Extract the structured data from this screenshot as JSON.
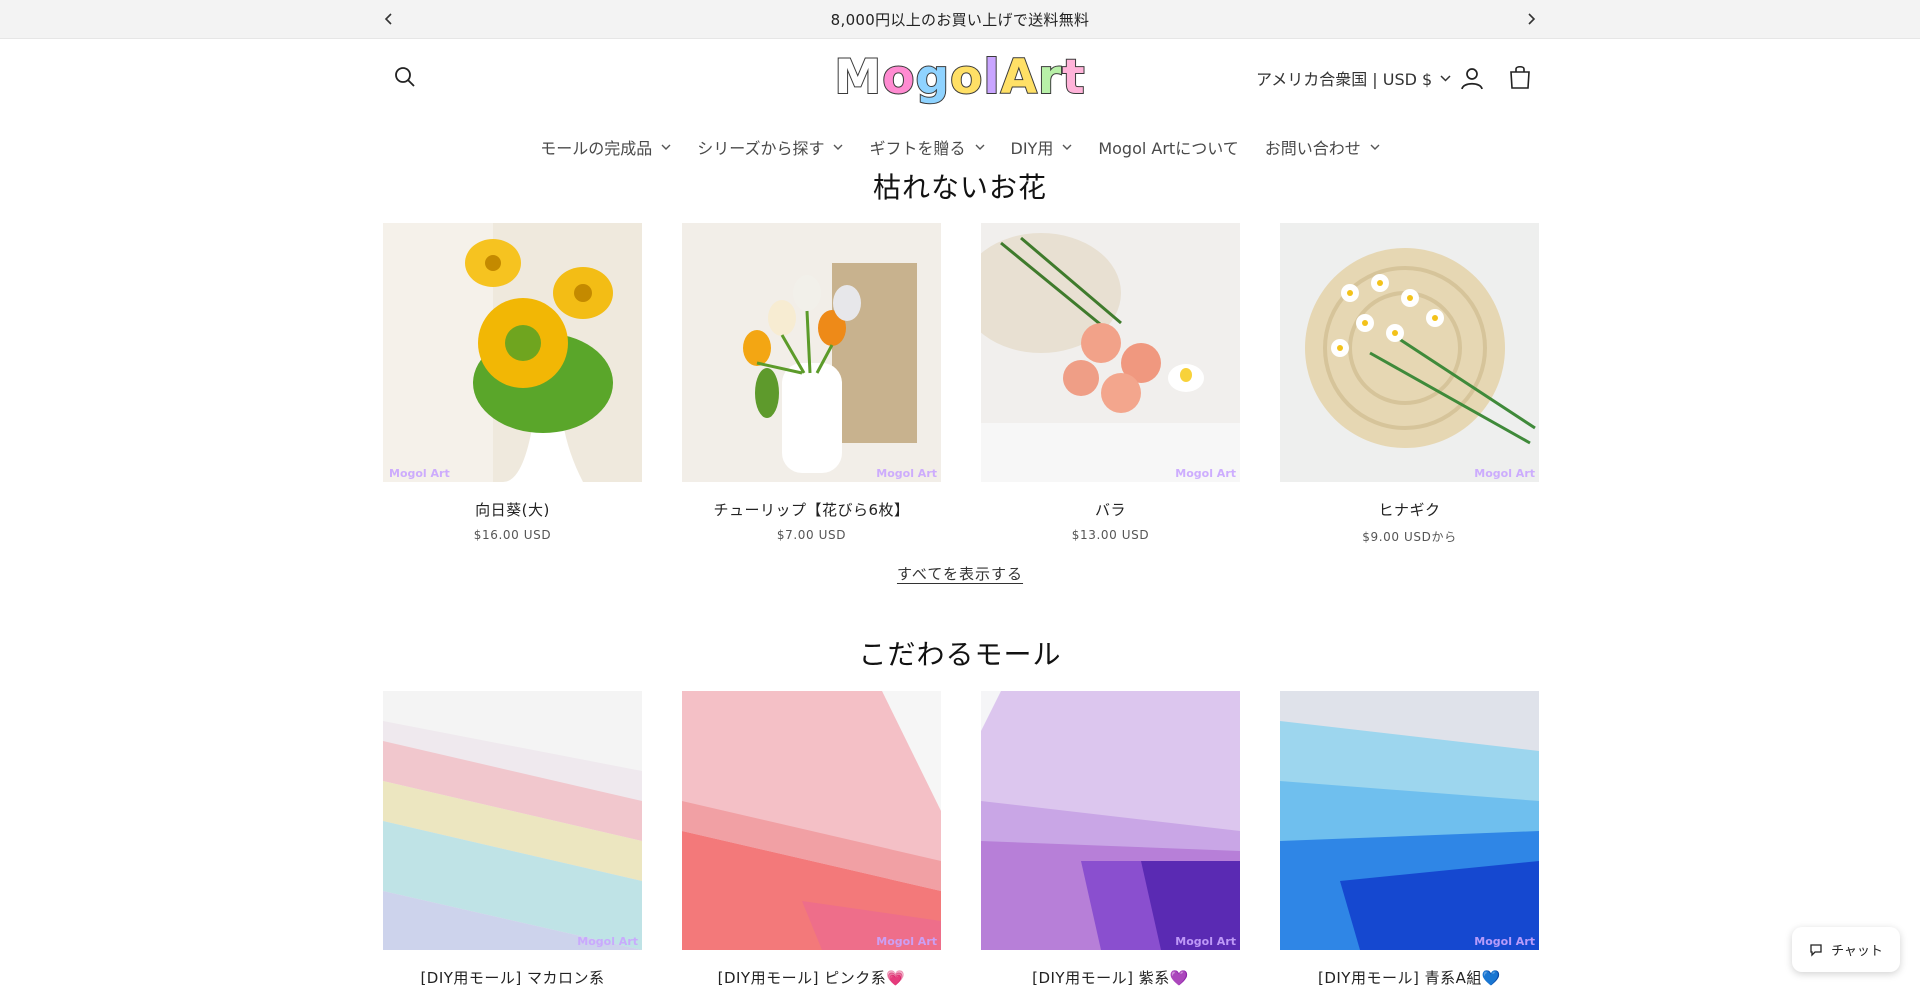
{
  "announcement": {
    "text": "8,000円以上のお買い上げで送料無料"
  },
  "header": {
    "logo_text": "Mogol Art",
    "logo_letters": [
      {
        "ch": "M",
        "color": "#ffffff"
      },
      {
        "ch": "o",
        "color": "#ff8bd1"
      },
      {
        "ch": "g",
        "color": "#8fd3ff"
      },
      {
        "ch": "o",
        "color": "#ffe066"
      },
      {
        "ch": "l",
        "color": "#c9a5ff"
      },
      {
        "ch": " ",
        "color": "#ffffff"
      },
      {
        "ch": "A",
        "color": "#ffe066"
      },
      {
        "ch": "r",
        "color": "#b8f0a8"
      },
      {
        "ch": "t",
        "color": "#ffb3d9"
      }
    ],
    "locale": "アメリカ合衆国 | USD $"
  },
  "nav": [
    {
      "label": "モールの完成品",
      "dropdown": true
    },
    {
      "label": "シリーズから探す",
      "dropdown": true
    },
    {
      "label": "ギフトを贈る",
      "dropdown": true
    },
    {
      "label": "DIY用",
      "dropdown": true
    },
    {
      "label": "Mogol Artについて",
      "dropdown": false
    },
    {
      "label": "お問い合わせ",
      "dropdown": true
    }
  ],
  "sections": [
    {
      "title": "枯れないお花",
      "view_all": "すべてを表示する",
      "products": [
        {
          "title": "向日葵(大)",
          "price": "$16.00 USD",
          "watermark": "Mogol Art"
        },
        {
          "title": "チューリップ【花びら6枚】",
          "price": "$7.00 USD",
          "watermark": "Mogol Art"
        },
        {
          "title": "バラ",
          "price": "$13.00 USD",
          "watermark": "Mogol Art"
        },
        {
          "title": "ヒナギク",
          "price": "$9.00 USDから",
          "watermark": "Mogol Art"
        }
      ]
    },
    {
      "title": "こだわるモール",
      "products": [
        {
          "title": "[DIY用モール] マカロン系",
          "watermark": "Mogol Art"
        },
        {
          "title": "[DIY用モール] ピンク系💗",
          "watermark": "Mogol Art"
        },
        {
          "title": "[DIY用モール] 紫系💜",
          "watermark": "Mogol Art"
        },
        {
          "title": "[DIY用モール] 青系A組💙",
          "watermark": "Mogol Art"
        }
      ]
    }
  ],
  "chat": {
    "label": "チャット"
  }
}
